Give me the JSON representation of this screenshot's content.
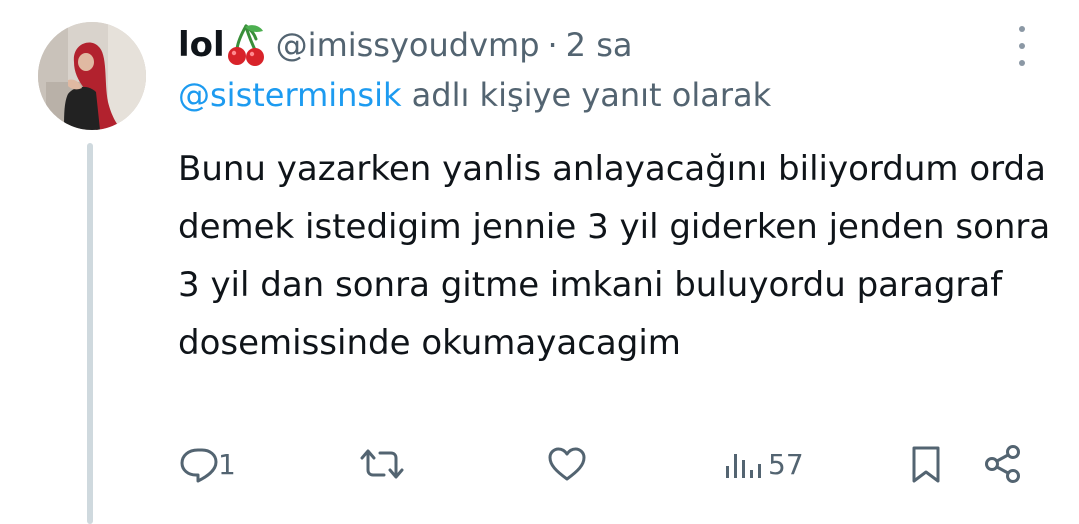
{
  "tweet": {
    "display_name": "lol",
    "name_emoji": "cherry-emoji",
    "handle": "@imissyoudvmp",
    "separator": "·",
    "time": "2 sa",
    "reply_mention": "@sisterminsik",
    "reply_suffix": " adlı kişiye yanıt olarak",
    "text": "Bunu yazarken yanlis anlayacağını biliyordum orda demek istedigim jennie 3 yil giderken jenden sonra 3 yil dan sonra gitme imkani buluyordu paragraf dosemissinde okumayacagim"
  },
  "actions": {
    "reply": {
      "icon": "reply-icon",
      "count": "1"
    },
    "retweet": {
      "icon": "retweet-icon",
      "count": ""
    },
    "like": {
      "icon": "heart-icon",
      "count": ""
    },
    "views": {
      "icon": "views-icon",
      "count": "57"
    },
    "bookmark": {
      "icon": "bookmark-icon"
    },
    "share": {
      "icon": "share-icon"
    }
  },
  "colors": {
    "text": "#0f1419",
    "secondary": "#536471",
    "mention": "#1d9bf0",
    "thread_line": "#cfd9de",
    "cherry": "#d8232a",
    "cherry_stem": "#3a8f3a"
  }
}
